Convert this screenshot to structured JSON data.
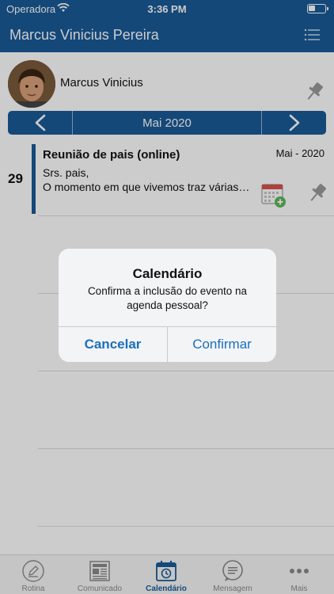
{
  "status_bar": {
    "carrier": "Operadora",
    "time": "3:36 PM"
  },
  "header": {
    "title": "Marcus Vinicius Pereira"
  },
  "profile": {
    "name": "Marcus Vinicius"
  },
  "calendar": {
    "month_label": "Mai 2020"
  },
  "events": [
    {
      "day": "29",
      "title": "Reunião de pais (online)",
      "date": "Mai - 2020",
      "line1": "Srs. pais,",
      "line2": "O momento em que vivemos traz várias…"
    }
  ],
  "dialog": {
    "title": "Calendário",
    "message": "Confirma a inclusão do evento na agenda pessoal?",
    "cancel_label": "Cancelar",
    "confirm_label": "Confirmar"
  },
  "tabs": [
    {
      "label": "Rotina",
      "icon": "pencil-icon"
    },
    {
      "label": "Comunicado",
      "icon": "newspaper-icon"
    },
    {
      "label": "Calendário",
      "icon": "calendar-icon",
      "active": true
    },
    {
      "label": "Mensagem",
      "icon": "chat-icon"
    },
    {
      "label": "Mais",
      "icon": "more-icon"
    }
  ],
  "colors": {
    "primary": "#1a5b98",
    "accent": "#1a6fbf"
  }
}
